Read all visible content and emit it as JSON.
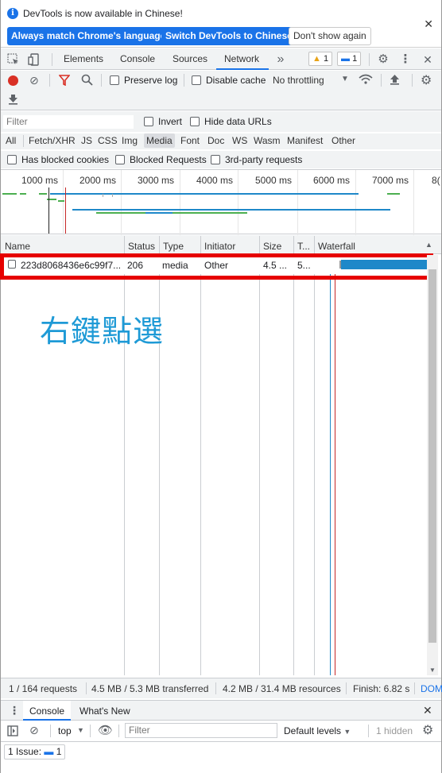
{
  "infobar": {
    "message": "DevTools is now available in Chinese!",
    "btn_match": "Always match Chrome's language",
    "btn_switch": "Switch DevTools to Chinese",
    "btn_dont_show": "Don't show again"
  },
  "tabs": [
    "Elements",
    "Console",
    "Sources",
    "Network"
  ],
  "active_tab": "Network",
  "badges": {
    "warnings": "1",
    "messages": "1"
  },
  "toolbar": {
    "preserve_log": "Preserve log",
    "disable_cache": "Disable cache",
    "throttling": "No throttling"
  },
  "filter": {
    "placeholder": "Filter",
    "invert": "Invert",
    "hide_data_urls": "Hide data URLs",
    "types": [
      "All",
      "Fetch/XHR",
      "JS",
      "CSS",
      "Img",
      "Media",
      "Font",
      "Doc",
      "WS",
      "Wasm",
      "Manifest",
      "Other"
    ],
    "selected_type": "Media",
    "has_blocked_cookies": "Has blocked cookies",
    "blocked_requests": "Blocked Requests",
    "third_party": "3rd-party requests"
  },
  "overview_ticks": [
    "1000 ms",
    "2000 ms",
    "3000 ms",
    "4000 ms",
    "5000 ms",
    "6000 ms",
    "7000 ms",
    "8("
  ],
  "table": {
    "headers": [
      "Name",
      "Status",
      "Type",
      "Initiator",
      "Size",
      "T...",
      "Waterfall"
    ],
    "rows": [
      {
        "name": "223d8068436e6c99f7...",
        "status": "206",
        "type": "media",
        "initiator": "Other",
        "size": "4.5 ...",
        "time": "5..."
      }
    ]
  },
  "annotation": "右鍵點選",
  "status": {
    "requests": "1 / 164 requests",
    "transferred": "4.5 MB / 5.3 MB transferred",
    "resources": "4.2 MB / 31.4 MB resources",
    "finish": "Finish: 6.82 s",
    "dom": "DOM"
  },
  "drawer": {
    "tabs": [
      "Console",
      "What's New"
    ],
    "context": "top",
    "filter_placeholder": "Filter",
    "levels": "Default levels",
    "hidden": "1 hidden"
  },
  "issues": {
    "label": "1 Issue:",
    "count": "1"
  },
  "colors": {
    "accent": "#1a73e8",
    "highlight": "#e60000",
    "annotation": "#1e9ad6"
  }
}
